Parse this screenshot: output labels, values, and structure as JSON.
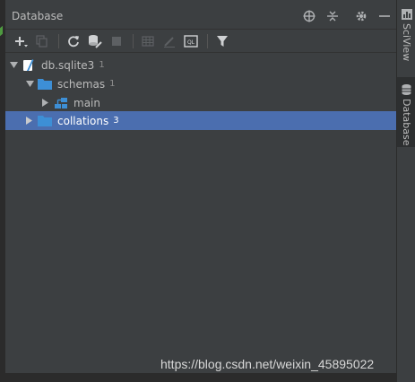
{
  "panel": {
    "title": "Database",
    "title_icons": [
      "add-target-icon",
      "collapse-icon",
      "gear-icon",
      "minimize-icon"
    ]
  },
  "toolbar": {
    "buttons": [
      "add-icon",
      "copy-icon",
      "refresh-icon",
      "schema-properties-icon",
      "stop-icon",
      "table-editor-icon",
      "edit-icon",
      "sql-console-icon",
      "filter-icon"
    ]
  },
  "tree": {
    "db": {
      "label": "db.sqlite3",
      "count": "1"
    },
    "schemas": {
      "label": "schemas",
      "count": "1"
    },
    "main": {
      "label": "main"
    },
    "collations": {
      "label": "collations",
      "count": "3"
    }
  },
  "right_tabs": {
    "sciview": "SciView",
    "database": "Database"
  },
  "watermark": "https://blog.csdn.net/weixin_45895022",
  "colors": {
    "background": "#3c3f41",
    "selection": "#4b6eaf",
    "folder": "#3d8fd6",
    "text": "#bbbbbb"
  }
}
